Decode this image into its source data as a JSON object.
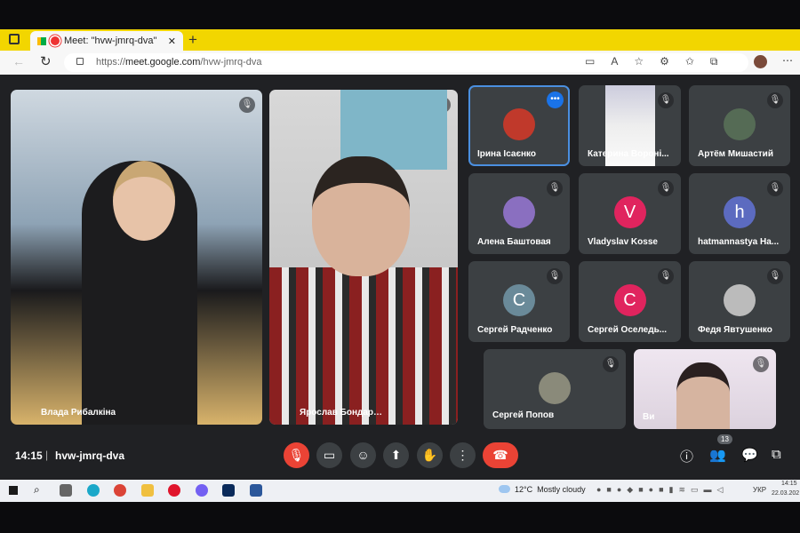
{
  "browser": {
    "tab_title": "Meet: \"hvw-jmrq-dva\"",
    "url_scheme": "https://",
    "url_host": "meet.google.com",
    "url_path": "/hvw-jmrq-dva",
    "close": "✕",
    "new_tab": "+"
  },
  "main_tiles": [
    {
      "name": "Влада Рибалкіна"
    },
    {
      "name": "Ярослав Бондаренко"
    }
  ],
  "grid_tiles": [
    {
      "name": "Ірина Ісаєнко",
      "initial": "",
      "color": "#c0392b",
      "active": true
    },
    {
      "name": "Катерина Вороні...",
      "initial": "",
      "color": "#ddd"
    },
    {
      "name": "Артём Мишастий",
      "initial": "",
      "color": "#556b55"
    },
    {
      "name": "Алена Баштовая",
      "initial": "",
      "color": "#8a6fc0"
    },
    {
      "name": "Vladyslav Kosse",
      "initial": "V",
      "color": "#e0245e"
    },
    {
      "name": "hatmannastya Ha...",
      "initial": "h",
      "color": "#5c6bc0"
    },
    {
      "name": "Сергей Радченко",
      "initial": "C",
      "color": "#6a8a99"
    },
    {
      "name": "Сергей Оселедь...",
      "initial": "C",
      "color": "#e0245e"
    },
    {
      "name": "Федя Явтушенко",
      "initial": "",
      "color": "#bbb"
    },
    {
      "name": "Сергей Попов",
      "initial": "",
      "color": "#8a8a7a"
    },
    {
      "name": "Ви",
      "initial": "",
      "color": "#e8dfe9"
    }
  ],
  "bottom": {
    "time": "14:15",
    "separator": "|",
    "meeting_code": "hvw-jmrq-dva",
    "participants_count": "13"
  },
  "taskbar": {
    "weather": "12°C  Mostly cloudy",
    "lang": "УКР",
    "clock_time": "14:15",
    "clock_date": "22.03.202"
  },
  "colors": {
    "accent": "#1a73e8",
    "danger": "#ea4335",
    "meet_bg": "#202124"
  }
}
